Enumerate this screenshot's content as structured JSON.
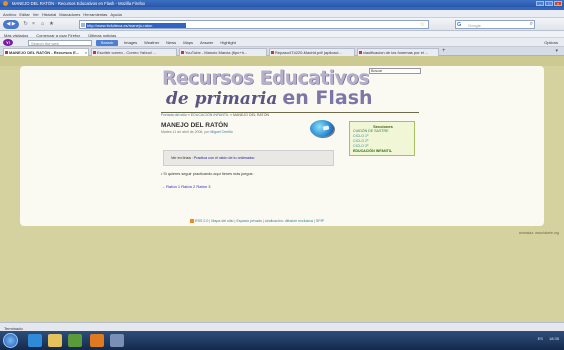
{
  "browser": {
    "window_title": "MANEJO DEL RATÓN - Recursos Educativos en Flash - Mozilla Firefox",
    "menu": [
      "Archivo",
      "Editar",
      "Ver",
      "Historial",
      "Marcadores",
      "Herramientas",
      "Ayuda"
    ],
    "url": "http://www.ticfulteca.es/manejo-raton",
    "search_engine": "Google",
    "search_placeholder": "Google",
    "bookmarks": [
      "Más visitados",
      "Comenzar a usar Firefox",
      "Últimas noticias"
    ],
    "yahoo_search_placeholder": "Search the web",
    "yahoo_search_button": "Search",
    "toolbar_items": [
      "Images",
      "Weather",
      "News",
      "Maps",
      "Answer",
      "Highlight"
    ],
    "toolbar_options": "Options",
    "tabs": [
      {
        "label": "MANEJO DEL RATÓN - Recursos E...",
        "active": true
      },
      {
        "label": "Escribir correo - Correo Yahoo! ...",
        "active": false
      },
      {
        "label": "YouTube - Manolo Marcia (tipo+h...",
        "active": false
      },
      {
        "label": "Repaso4T4220-Madrid.pdf (aplicaci...",
        "active": false
      },
      {
        "label": "clasificacion de los fonemas por el ...",
        "active": false
      }
    ],
    "status": "Terminado"
  },
  "site": {
    "title_line1": "Recursos Educativos",
    "title_script": "de primaria",
    "title_flash": "en Flash",
    "search_value": "Buscar",
    "breadcrumb": {
      "home": "Portada del sitio",
      "sep": " » ",
      "section": "EDUCACIÓN INFANTIL",
      "current": "MANEJO DEL RATÓN"
    },
    "post": {
      "title": "MANEJO DEL RATÓN",
      "meta_prefix": "Martes 11 de abril de 2006, por ",
      "author": "Miguel Cerrillo"
    },
    "sections": {
      "title": "Secciones",
      "items": [
        "CUIDÓN DE SASTRE",
        "CICLO 1º",
        "CICLO 2º",
        "CICLO 3º",
        "EDUCACIÓN INFANTIL"
      ]
    },
    "play": {
      "prefix": "Ver en línea : ",
      "link": "Practica con el ratón de tu ordenador."
    },
    "practice_text": "Si quieres seguir practicando aquí tienes más juegos:",
    "games": {
      "arrow": "→ ",
      "links": [
        "Ratón 1",
        "Ratón 2",
        "Ratón 3"
      ]
    },
    "footer": [
      "RSS 2.0",
      "Mapa del sitio",
      "Espacio privado",
      "sindicación: difusión exclusiva",
      "SPIP"
    ],
    "right_note": "amankaz: www.tabele.org"
  },
  "taskbar": {
    "tray_text": [
      "ES",
      "18:35"
    ]
  },
  "colors": {
    "page_bg": "#d5d2a0",
    "sheet_bg": "#fbfaf2",
    "title_main": "#b4afca",
    "title_script": "#5b5583",
    "link": "#3a7c94",
    "sections_bg": "#f1f6d6"
  }
}
